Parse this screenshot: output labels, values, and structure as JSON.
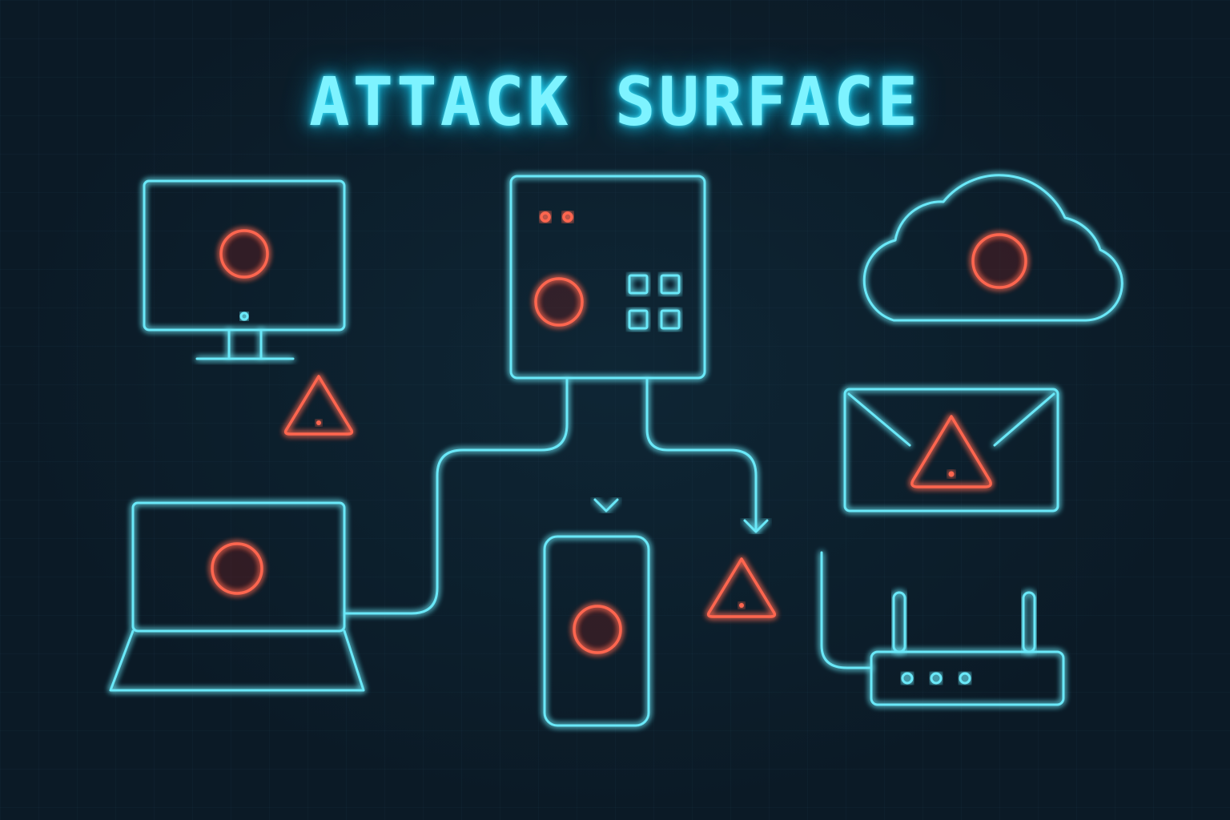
{
  "title": "ATTACK SURFACE",
  "colors": {
    "background": "#0b1a26",
    "node_outline": "#6ae8f8",
    "threat": "#ff6650",
    "title": "#7ef3ff"
  },
  "nodes": [
    {
      "id": "desktop",
      "icon": "desktop-monitor-icon",
      "status": "compromised"
    },
    {
      "id": "server",
      "icon": "server-dashboard-icon",
      "status": "compromised"
    },
    {
      "id": "cloud",
      "icon": "cloud-icon",
      "status": "compromised"
    },
    {
      "id": "email",
      "icon": "email-envelope-icon",
      "status": "warning"
    },
    {
      "id": "laptop",
      "icon": "laptop-icon",
      "status": "compromised"
    },
    {
      "id": "smartphone",
      "icon": "smartphone-icon",
      "status": "compromised"
    },
    {
      "id": "router",
      "icon": "wifi-router-icon",
      "status": "normal"
    }
  ],
  "edges": [
    {
      "from": "desktop",
      "to": "server"
    },
    {
      "from": "server",
      "to": "cloud"
    },
    {
      "from": "cloud",
      "to": "email"
    },
    {
      "from": "server",
      "to": "laptop"
    },
    {
      "from": "server",
      "to": "smartphone"
    },
    {
      "from": "server",
      "to": "warning-center"
    }
  ],
  "warnings": [
    "warning-desktop",
    "warning-center",
    "warning-email"
  ]
}
